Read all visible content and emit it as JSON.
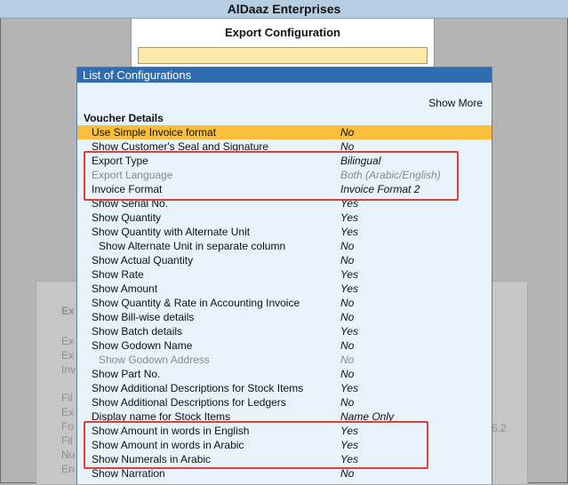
{
  "app": {
    "company": "AlDaaz Enterprises"
  },
  "export_screen": {
    "title": "Export Configuration",
    "input_value": ""
  },
  "background_labels": [
    "Ex",
    "Ex",
    "Ex",
    "Inv",
    "Fil",
    "Ex",
    "Fo",
    "Fil",
    "Nu",
    "En",
    "6.2"
  ],
  "config": {
    "header": "List of Configurations",
    "show_more": "Show More",
    "section_title": "Voucher Details",
    "rows": [
      {
        "label": "Use Simple Invoice format",
        "value": "No"
      },
      {
        "label": "Show Customer's Seal and Signature",
        "value": "No"
      },
      {
        "label": "Export Type",
        "value": "Bilingual"
      },
      {
        "label": "Export Language",
        "value": "Both (Arabic/English)"
      },
      {
        "label": "Invoice Format",
        "value": "Invoice Format 2"
      },
      {
        "label": "Show Serial No.",
        "value": "Yes"
      },
      {
        "label": "Show Quantity",
        "value": "Yes"
      },
      {
        "label": "Show Quantity with Alternate Unit",
        "value": "Yes"
      },
      {
        "label": "Show Alternate Unit in separate column",
        "value": "No"
      },
      {
        "label": "Show Actual Quantity",
        "value": "No"
      },
      {
        "label": "Show Rate",
        "value": "Yes"
      },
      {
        "label": "Show Amount",
        "value": "Yes"
      },
      {
        "label": "Show Quantity & Rate in Accounting Invoice",
        "value": "No"
      },
      {
        "label": "Show Bill-wise details",
        "value": "No"
      },
      {
        "label": "Show Batch details",
        "value": "Yes"
      },
      {
        "label": "Show Godown Name",
        "value": "No"
      },
      {
        "label": "Show Godown Address",
        "value": "No"
      },
      {
        "label": "Show Part No.",
        "value": "No"
      },
      {
        "label": "Show Additional Descriptions for Stock Items",
        "value": "Yes"
      },
      {
        "label": "Show Additional Descriptions for Ledgers",
        "value": "No"
      },
      {
        "label": "Display name for Stock Items",
        "value": "Name Only"
      },
      {
        "label": "Show Amount in words in English",
        "value": "Yes"
      },
      {
        "label": "Show Amount in words in Arabic",
        "value": "Yes"
      },
      {
        "label": "Show Numerals in Arabic",
        "value": "Yes"
      },
      {
        "label": "Show Narration",
        "value": "No"
      }
    ]
  },
  "colors": {
    "header_bg": "#2f6cb0",
    "selected_row": "#fbbf3b",
    "highlight_box": "#d9403a",
    "panel_bg": "#e7f2fa"
  }
}
